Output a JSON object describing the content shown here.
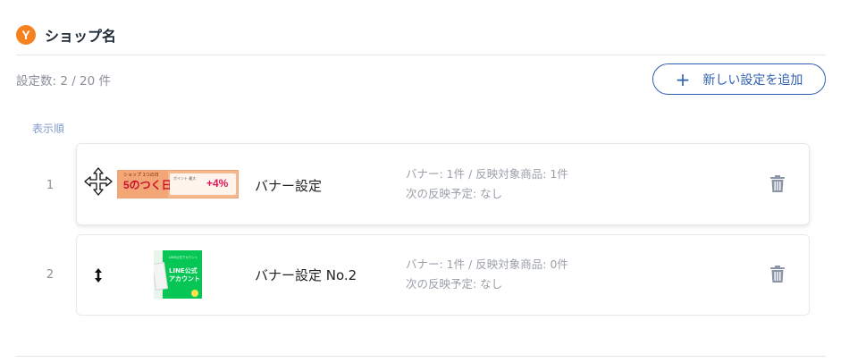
{
  "shop": {
    "logo_letter": "Y",
    "name": "ショップ名"
  },
  "settings_count": "設定数: 2 / 20 件",
  "add_button": {
    "icon": "plus-icon",
    "label": "新しい設定を追加"
  },
  "order_label": "表示順",
  "rows": [
    {
      "order": "1",
      "name": "バナー設定",
      "summary": "バナー: 1件 / 反映対象商品: 1件",
      "next_schedule": "次の反映予定: なし",
      "thumbnail": {
        "headline": "5のつく日",
        "badge": "+4%"
      },
      "drag_icon": "move-cross-icon",
      "delete_icon": "trash-icon"
    },
    {
      "order": "2",
      "name": "バナー設定 No.2",
      "summary": "バナー: 1件 / 反映対象商品: 0件",
      "next_schedule": "次の反映予定: なし",
      "thumbnail": {
        "headline": "LINE公式\nアカウント"
      },
      "drag_icon": "up-down-arrow-icon",
      "delete_icon": "trash-icon"
    }
  ],
  "colors": {
    "accent": "#2f5fb3",
    "logo": "#f5821f",
    "muted": "#9aa0a8",
    "label_blue": "#7f9bc8"
  }
}
